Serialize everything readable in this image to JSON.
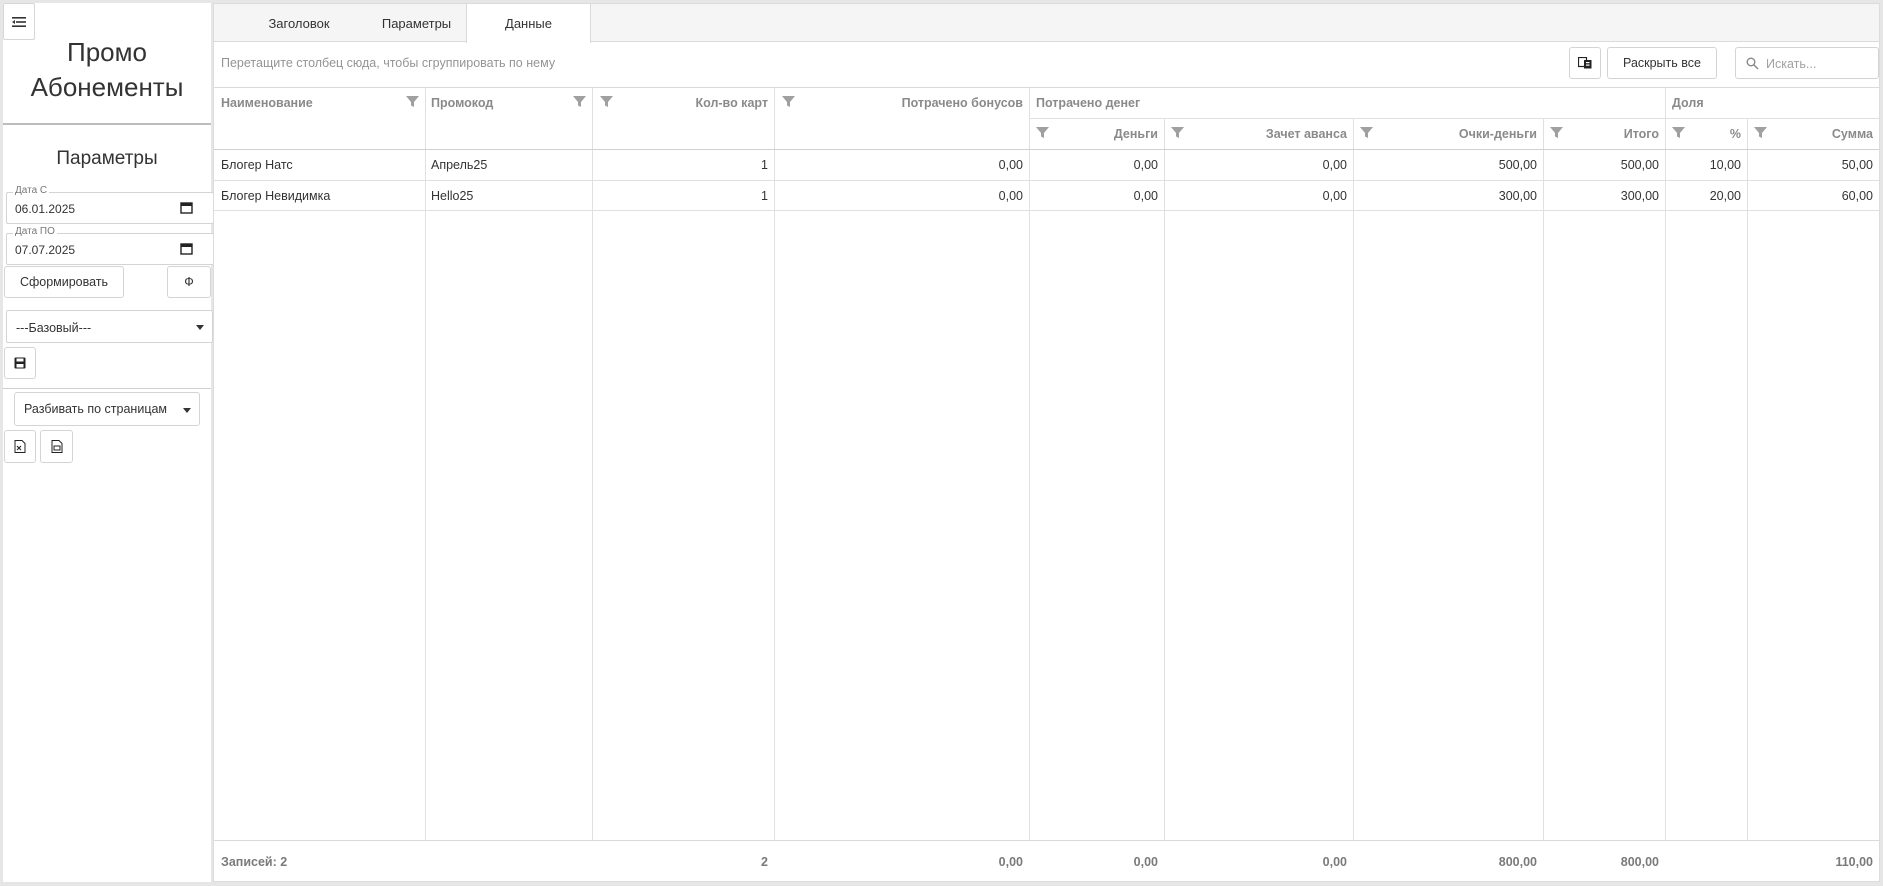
{
  "sidebar": {
    "title_line1": "Промо",
    "title_line2": "Абонементы",
    "params_title": "Параметры",
    "date_from": {
      "label": "Дата С",
      "value": "06.01.2025"
    },
    "date_to": {
      "label": "Дата ПО",
      "value": "07.07.2025"
    },
    "generate_label": "Сформировать",
    "filter_label": "Ф",
    "layout_select": "---Базовый---",
    "paging_select": "Разбивать по страницам"
  },
  "tabs": [
    {
      "label": "Заголовок",
      "active": false
    },
    {
      "label": "Параметры",
      "active": false
    },
    {
      "label": "Данные",
      "active": true
    }
  ],
  "toolbar": {
    "group_hint": "Перетащите столбец сюда, чтобы сгруппировать по нему",
    "expand_all": "Раскрыть все",
    "search_placeholder": "Искать..."
  },
  "grid": {
    "headers": {
      "name": "Наименование",
      "promo": "Промокод",
      "cards": "Кол-во карт",
      "bonus": "Потрачено бонусов",
      "money_group": "Потрачено денег",
      "money": "Деньги",
      "advance": "Зачет аванса",
      "points": "Очки-деньги",
      "total": "Итого",
      "share_group": "Доля",
      "percent": "%",
      "sum": "Сумма"
    },
    "rows": [
      {
        "name": "Блогер Натс",
        "promo": "Апрель25",
        "cards": "1",
        "bonus": "0,00",
        "money": "0,00",
        "advance": "0,00",
        "points": "500,00",
        "total": "500,00",
        "percent": "10,00",
        "sum": "50,00"
      },
      {
        "name": "Блогер Невидимка",
        "promo": "Hello25",
        "cards": "1",
        "bonus": "0,00",
        "money": "0,00",
        "advance": "0,00",
        "points": "300,00",
        "total": "300,00",
        "percent": "20,00",
        "sum": "60,00"
      }
    ],
    "footer": {
      "records": "Записей: 2",
      "cards": "2",
      "bonus": "0,00",
      "money": "0,00",
      "advance": "0,00",
      "points": "800,00",
      "total": "800,00",
      "sum": "110,00"
    }
  }
}
